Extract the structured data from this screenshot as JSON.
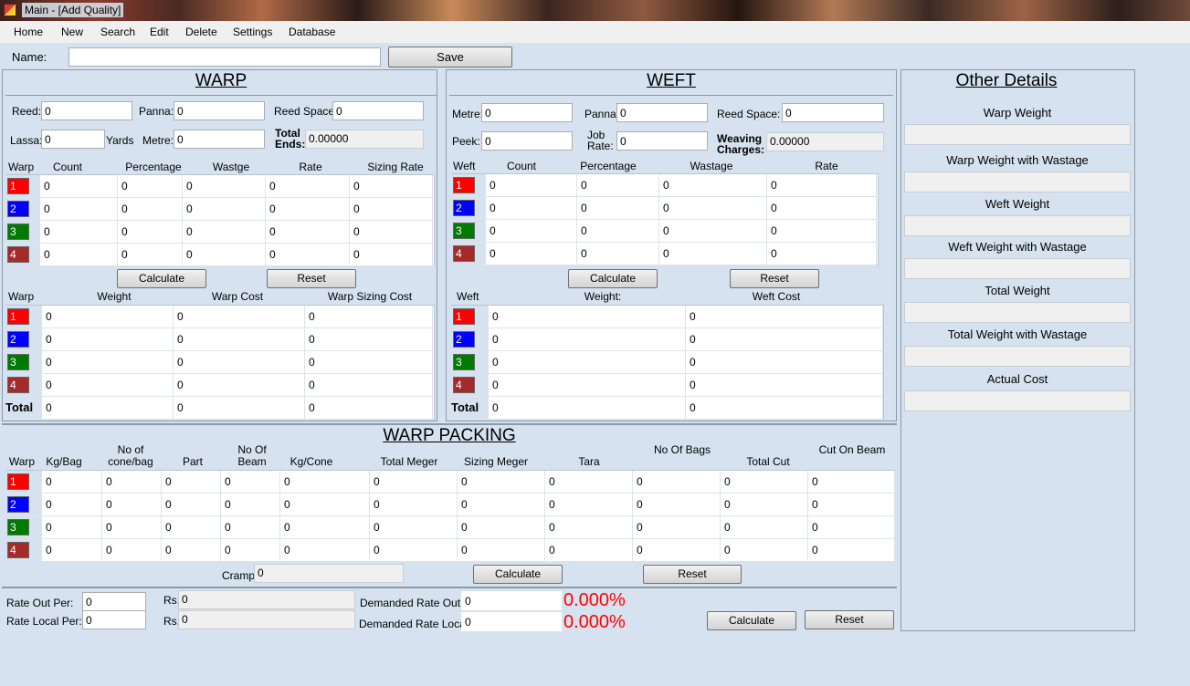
{
  "window": {
    "title": "Main - [Add Quality]"
  },
  "menu": [
    "Home",
    "New",
    "Search",
    "Edit",
    "Delete",
    "Settings",
    "Database"
  ],
  "name_row": {
    "label": "Name:",
    "value": "",
    "save": "Save"
  },
  "warp": {
    "heading": "WARP",
    "fields": {
      "reed_label": "Reed:",
      "reed": "0",
      "panna_label": "Panna:",
      "panna": "0",
      "reed_space_label": "Reed Space:",
      "reed_space": "0",
      "lassa_label": "Lassa:",
      "lassa": "0",
      "yards_label": "Yards",
      "metre_label": "Metre:",
      "metre": "0",
      "total_ends_label": "Total Ends:",
      "total_ends": "0.00000"
    },
    "grid1_headers": [
      "Warp",
      "Count",
      "Percentage",
      "Wastge",
      "Rate",
      "Sizing Rate"
    ],
    "grid1_rows": [
      [
        "1",
        "0",
        "0",
        "0",
        "0",
        "0"
      ],
      [
        "2",
        "0",
        "0",
        "0",
        "0",
        "0"
      ],
      [
        "3",
        "0",
        "0",
        "0",
        "0",
        "0"
      ],
      [
        "4",
        "0",
        "0",
        "0",
        "0",
        "0"
      ]
    ],
    "calculate": "Calculate",
    "reset": "Reset",
    "grid2_headers": [
      "Warp",
      "Weight",
      "Warp Cost",
      "Warp Sizing Cost"
    ],
    "grid2_rows": [
      [
        "1",
        "0",
        "0",
        "0"
      ],
      [
        "2",
        "0",
        "0",
        "0"
      ],
      [
        "3",
        "0",
        "0",
        "0"
      ],
      [
        "4",
        "0",
        "0",
        "0"
      ],
      [
        "Total",
        "0",
        "0",
        "0"
      ]
    ]
  },
  "weft": {
    "heading": "WEFT",
    "fields": {
      "metre_label": "Metre:",
      "metre": "0",
      "panna_label": "Panna:",
      "panna": "0",
      "reed_space_label": "Reed Space:",
      "reed_space": "0",
      "peek_label": "Peek:",
      "peek": "0",
      "job_rate_label": "Job Rate:",
      "job_rate": "0",
      "weaving_label": "Weaving Charges:",
      "weaving": "0.00000"
    },
    "grid1_headers": [
      "Weft",
      "Count",
      "Percentage",
      "Wastage",
      "Rate"
    ],
    "grid1_rows": [
      [
        "1",
        "0",
        "0",
        "0",
        "0"
      ],
      [
        "2",
        "0",
        "0",
        "0",
        "0"
      ],
      [
        "3",
        "0",
        "0",
        "0",
        "0"
      ],
      [
        "4",
        "0",
        "0",
        "0",
        "0"
      ]
    ],
    "calculate": "Calculate",
    "reset": "Reset",
    "grid2_headers": [
      "Weft",
      "Weight:",
      "Weft Cost"
    ],
    "grid2_rows": [
      [
        "1",
        "0",
        "0"
      ],
      [
        "2",
        "0",
        "0"
      ],
      [
        "3",
        "0",
        "0"
      ],
      [
        "4",
        "0",
        "0"
      ],
      [
        "Total",
        "0",
        "0"
      ]
    ]
  },
  "other": {
    "heading": "Other Details",
    "labels": [
      "Warp Weight",
      "Warp Weight with Wastage",
      "Weft Weight",
      "Weft Weight with Wastage",
      "Total Weight",
      "Total Weight with Wastage",
      "Actual Cost"
    ]
  },
  "packing": {
    "heading": "WARP PACKING",
    "headers": [
      "Warp",
      "Kg/Bag",
      "No of cone/bag",
      "Part",
      "No Of Beam",
      "Kg/Cone",
      "Total Meger",
      "Sizing Meger",
      "Tara",
      "No Of Bags",
      "Total Cut",
      "Cut On Beam"
    ],
    "rows": [
      [
        "1",
        "0",
        "0",
        "0",
        "0",
        "0",
        "0",
        "0",
        "0",
        "0",
        "0",
        "0"
      ],
      [
        "2",
        "0",
        "0",
        "0",
        "0",
        "0",
        "0",
        "0",
        "0",
        "0",
        "0",
        "0"
      ],
      [
        "3",
        "0",
        "0",
        "0",
        "0",
        "0",
        "0",
        "0",
        "0",
        "0",
        "0",
        "0"
      ],
      [
        "4",
        "0",
        "0",
        "0",
        "0",
        "0",
        "0",
        "0",
        "0",
        "0",
        "0",
        "0"
      ]
    ],
    "cramp_label": "Cramp",
    "cramp": "0",
    "calculate": "Calculate",
    "reset": "Reset"
  },
  "rates": {
    "rate_out_label": "Rate Out Per:",
    "rate_out": "0",
    "rate_local_label": "Rate Local Per:",
    "rate_local": "0",
    "rs_label": "Rs.",
    "rs_out": "0",
    "rs_local": "0",
    "demanded_out_label": "Demanded Rate Out",
    "demanded_out": "0",
    "demanded_local_label": "Demanded Rate Local",
    "demanded_local": "0",
    "pct_out": "0.000%",
    "pct_local": "0.000%",
    "calculate": "Calculate",
    "reset": "Reset"
  },
  "colors": {
    "row1": "#ff0000",
    "row2": "#0000ff",
    "row3": "#007a00",
    "row4": "#a52a2a",
    "percent": "#ff0000",
    "background": "#d6e2ef"
  }
}
